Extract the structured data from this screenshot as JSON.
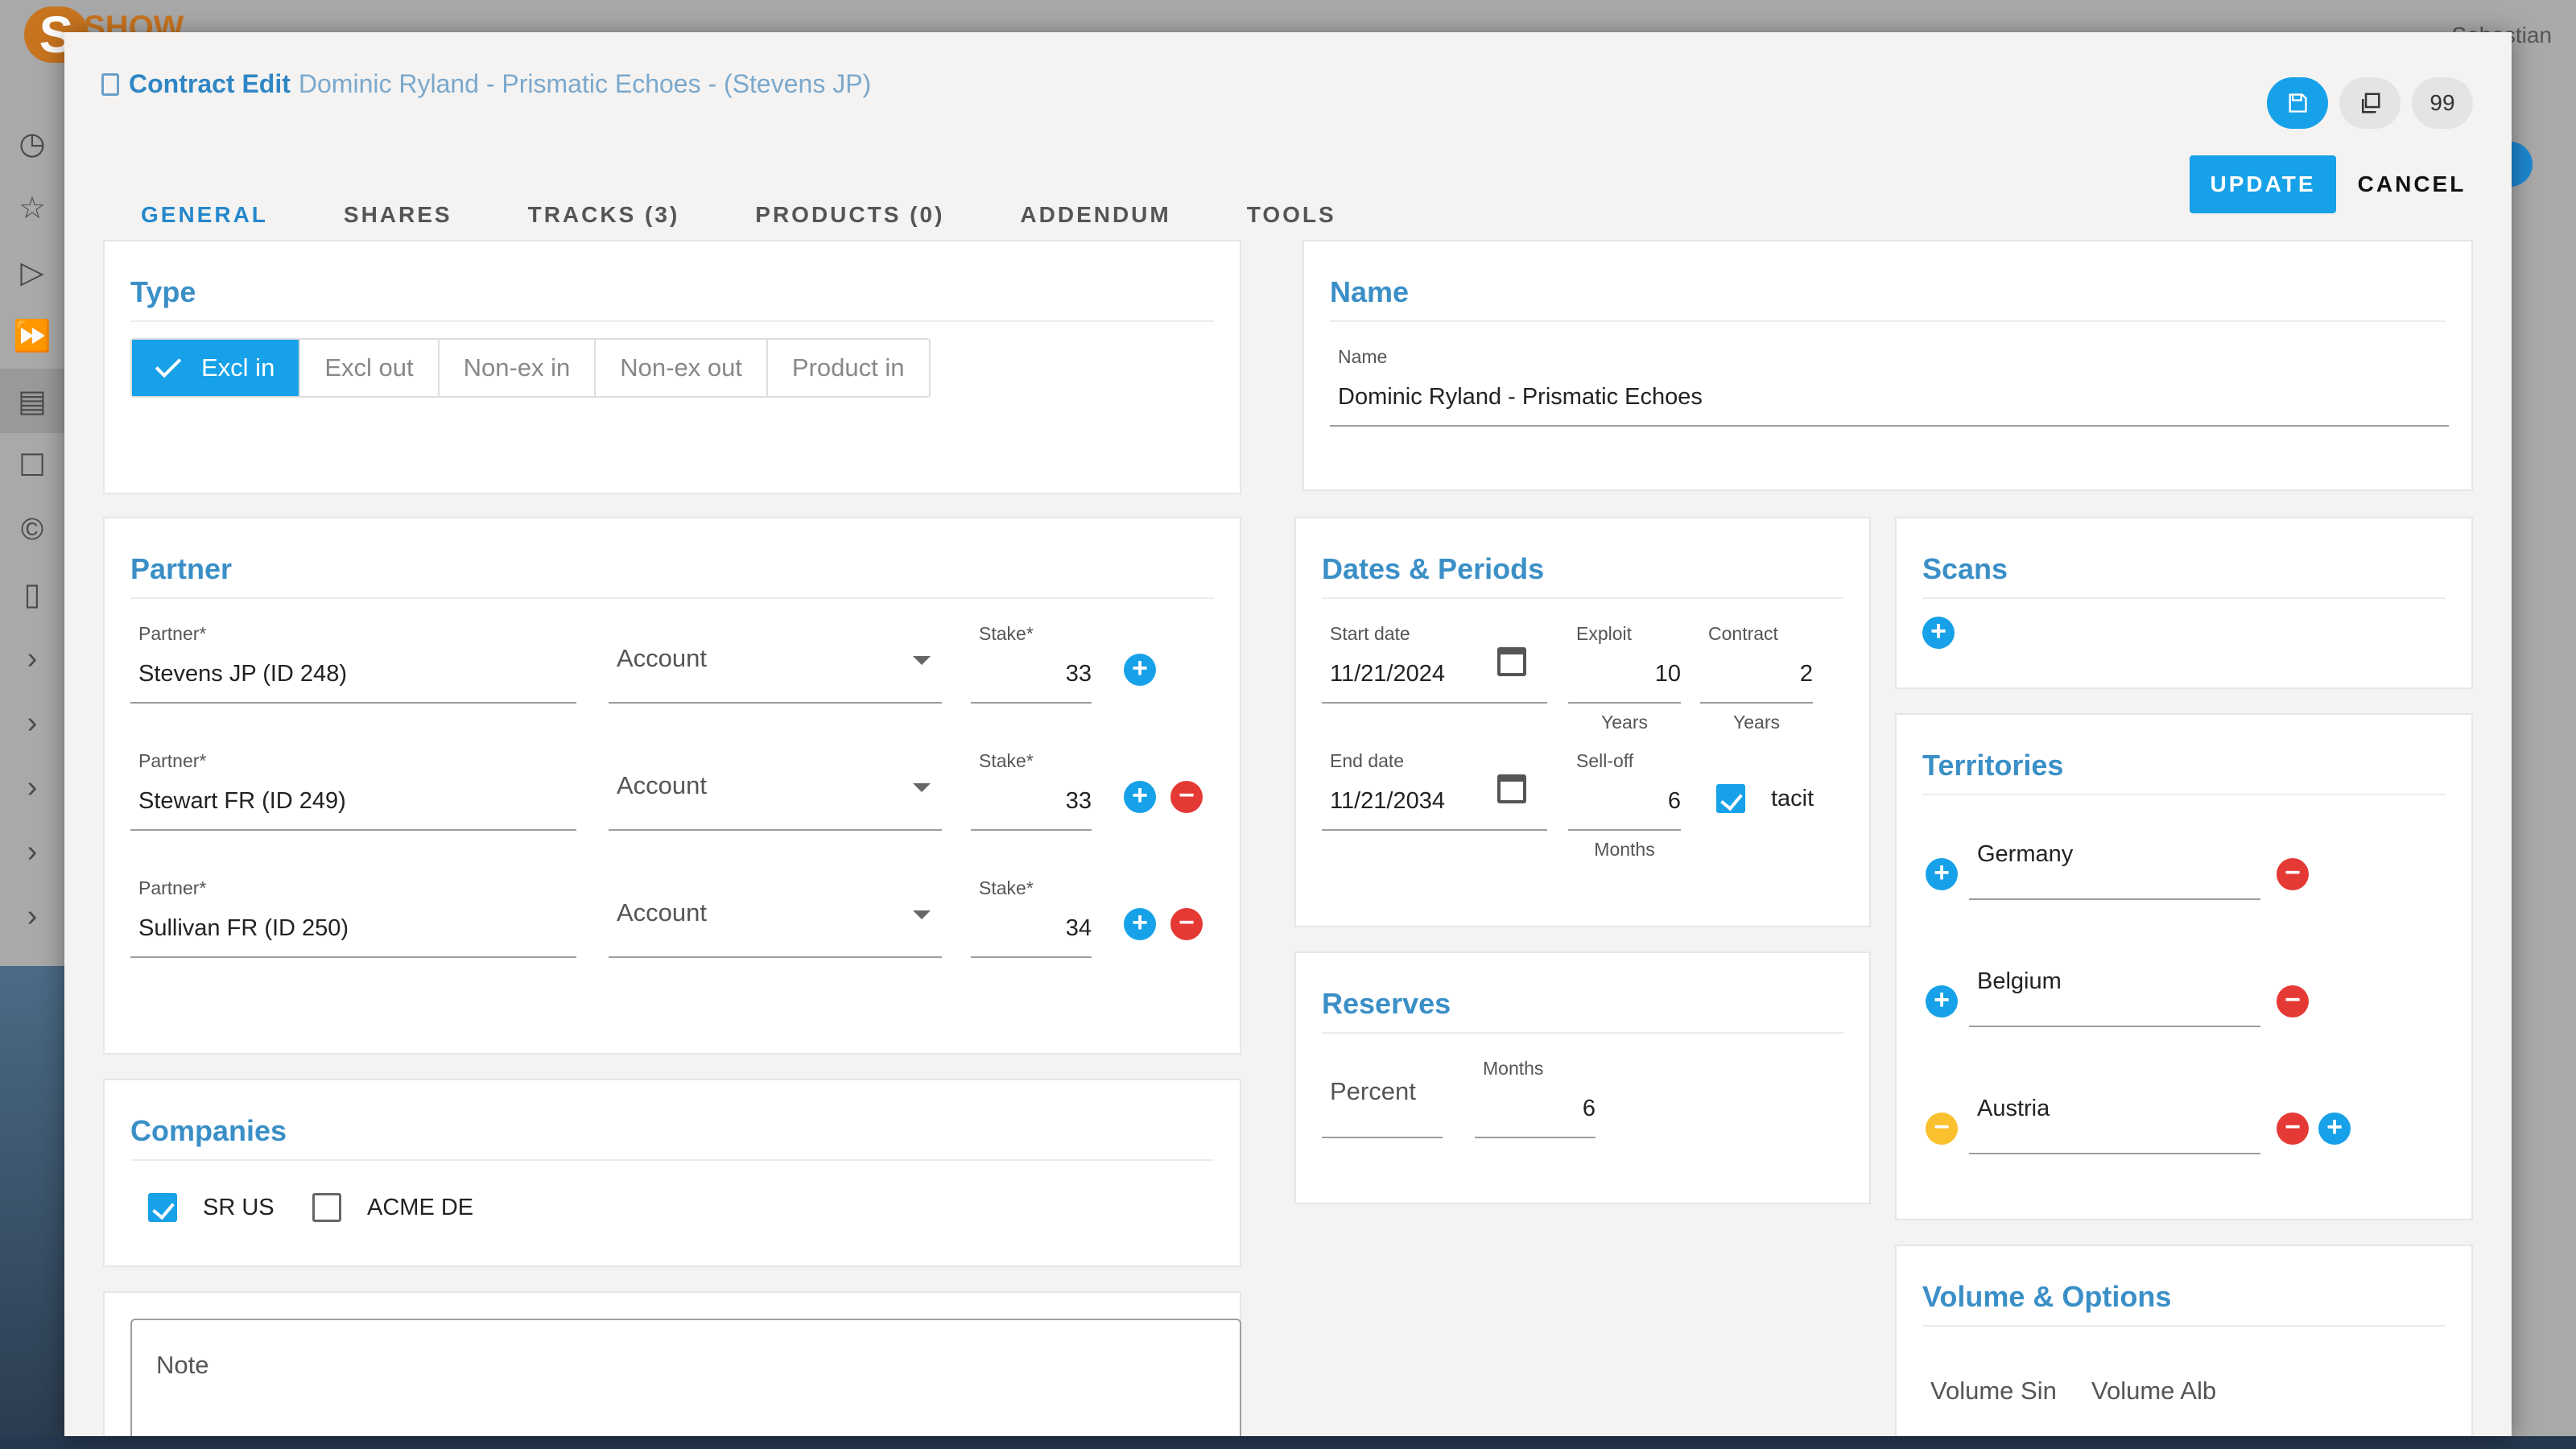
{
  "background": {
    "logo_letter": "S",
    "logo_text": "SHOW",
    "user": "Sebastian"
  },
  "dialog": {
    "title": "Contract Edit",
    "subtitle": "Dominic Ryland - Prismatic Echoes - (Stevens JP)",
    "counter": "99",
    "tabs": [
      "GENERAL",
      "SHARES",
      "TRACKS (3)",
      "PRODUCTS (0)",
      "ADDENDUM",
      "TOOLS"
    ],
    "update_label": "UPDATE",
    "cancel_label": "CANCEL"
  },
  "type_panel": {
    "title": "Type",
    "options": [
      "Excl in",
      "Excl out",
      "Non-ex in",
      "Non-ex out",
      "Product in"
    ],
    "selected": "Excl in"
  },
  "name_panel": {
    "title": "Name",
    "label": "Name",
    "value": "Dominic Ryland - Prismatic Echoes"
  },
  "partner_panel": {
    "title": "Partner",
    "partner_label": "Partner*",
    "account_placeholder": "Account",
    "stake_label": "Stake*",
    "rows": [
      {
        "partner": "Stevens JP (ID 248)",
        "stake": "33"
      },
      {
        "partner": "Stewart FR (ID 249)",
        "stake": "33"
      },
      {
        "partner": "Sullivan FR (ID 250)",
        "stake": "34"
      }
    ]
  },
  "dates_panel": {
    "title": "Dates & Periods",
    "start_label": "Start date",
    "start_value": "11/21/2024",
    "exploit_label": "Exploit",
    "exploit_value": "10",
    "exploit_unit": "Years",
    "contract_label": "Contract",
    "contract_value": "2",
    "contract_unit": "Years",
    "end_label": "End date",
    "end_value": "11/21/2034",
    "selloff_label": "Sell-off",
    "selloff_value": "6",
    "selloff_unit": "Months",
    "tacit_label": "tacit"
  },
  "scans_panel": {
    "title": "Scans"
  },
  "territories_panel": {
    "title": "Territories",
    "items": [
      "Germany",
      "Belgium",
      "Austria"
    ]
  },
  "companies_panel": {
    "title": "Companies",
    "items": [
      {
        "label": "SR US",
        "checked": true
      },
      {
        "label": "ACME DE",
        "checked": false
      }
    ]
  },
  "reserves_panel": {
    "title": "Reserves",
    "percent_placeholder": "Percent",
    "months_label": "Months",
    "months_value": "6"
  },
  "note_panel": {
    "label": "Note"
  },
  "volume_panel": {
    "title": "Volume & Options",
    "volume_sin": "Volume Sin",
    "volume_alb": "Volume Alb"
  }
}
